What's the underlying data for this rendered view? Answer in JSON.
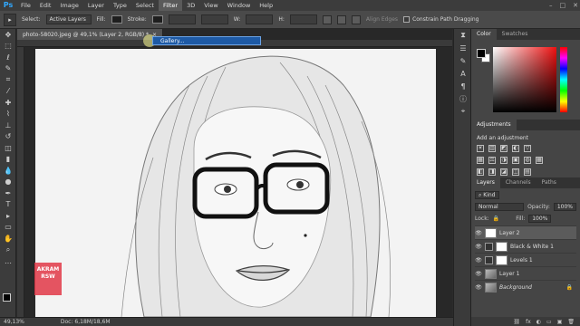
{
  "menubar": {
    "logo": "Ps",
    "items": [
      "File",
      "Edit",
      "Image",
      "Layer",
      "Type",
      "Select",
      "Filter",
      "3D",
      "View",
      "Window",
      "Help"
    ],
    "active_index": 6,
    "window_controls": [
      "–",
      "□",
      "✕"
    ]
  },
  "options": {
    "select_label": "Select:",
    "select_value": "Active Layers",
    "fill_label": "Fill:",
    "stroke_label": "Stroke:",
    "align_edges_label": "Align Edges",
    "constrain_label": "Constrain Path Dragging"
  },
  "document": {
    "tab_title": "photo-58020.jpeg @ 49,1% (Layer 2, RGB/8) *",
    "tab_close": "×",
    "dropdown_text": "Gallery...",
    "watermark": "AKRAM\nRSW"
  },
  "status": {
    "zoom": "49,13%",
    "doc_size": "Doc: 6,18M/18,6M"
  },
  "color_panel": {
    "tabs": [
      "Color",
      "Swatches"
    ],
    "active_tab": 0
  },
  "adjustments": {
    "tab": "Adjustments",
    "title": "Add an adjustment",
    "row1": [
      "☀",
      "▥",
      "◩",
      "◐",
      "▽"
    ],
    "row2": [
      "▦",
      "⚖",
      "◑",
      "▣",
      "◍",
      "▦"
    ],
    "row3": [
      "◧",
      "◨",
      "◪",
      "◫",
      "▤"
    ]
  },
  "layers": {
    "tabs": [
      "Layers",
      "Channels",
      "Paths"
    ],
    "active_tab": 0,
    "kind_label": "Kind",
    "blend_mode": "Normal",
    "opacity_label": "Opacity:",
    "opacity_value": "100%",
    "lock_label": "Lock:",
    "fill_label": "Fill:",
    "fill_value": "100%",
    "items": [
      {
        "name": "Layer 2",
        "selected": true
      },
      {
        "name": "Black & White 1",
        "selected": false
      },
      {
        "name": "Levels 1",
        "selected": false
      },
      {
        "name": "Layer 1",
        "selected": false
      },
      {
        "name": "Background",
        "selected": false
      }
    ],
    "footer_icons": [
      "fx",
      "◐",
      "▭",
      "▣",
      "🗑"
    ]
  }
}
